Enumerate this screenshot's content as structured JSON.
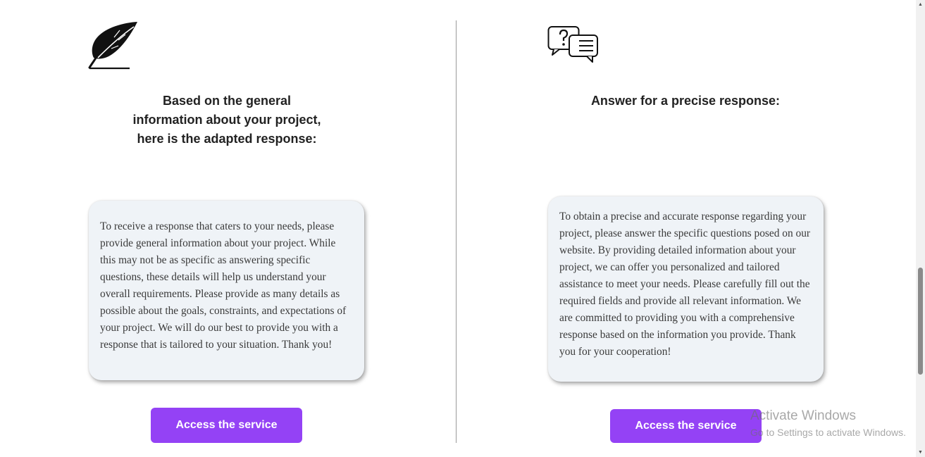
{
  "left": {
    "icon": "feather-quill-icon",
    "heading_lines": [
      "Based on the general",
      "information about your project,",
      "here is the adapted response:"
    ],
    "card_text": "To receive a response that caters to your needs, please provide general information about your project. While this may not be as specific as answering specific questions, these details will help us understand your overall requirements. Please provide as many details as possible about the goals, constraints, and expectations of your project. We will do our best to provide you with a response that is tailored to your situation. Thank you!",
    "button_label": "Access the service"
  },
  "right": {
    "icon": "question-chat-bubbles-icon",
    "heading": "Answer for a precise response:",
    "card_text": "To obtain a precise and accurate response regarding your project, please answer the specific questions posed on our website. By providing detailed information about your project, we can offer you personalized and tailored assistance to meet your needs. Please carefully fill out the required fields and provide all relevant information. We are committed to providing you with a comprehensive response based on the information you provide. Thank you for your cooperation!",
    "button_label": "Access the service"
  },
  "watermark": {
    "title": "Activate Windows",
    "subtitle": "Go to Settings to activate Windows."
  },
  "colors": {
    "button": "#9442f5",
    "card_background": "#eff3f7",
    "divider": "#9a9a9a"
  }
}
